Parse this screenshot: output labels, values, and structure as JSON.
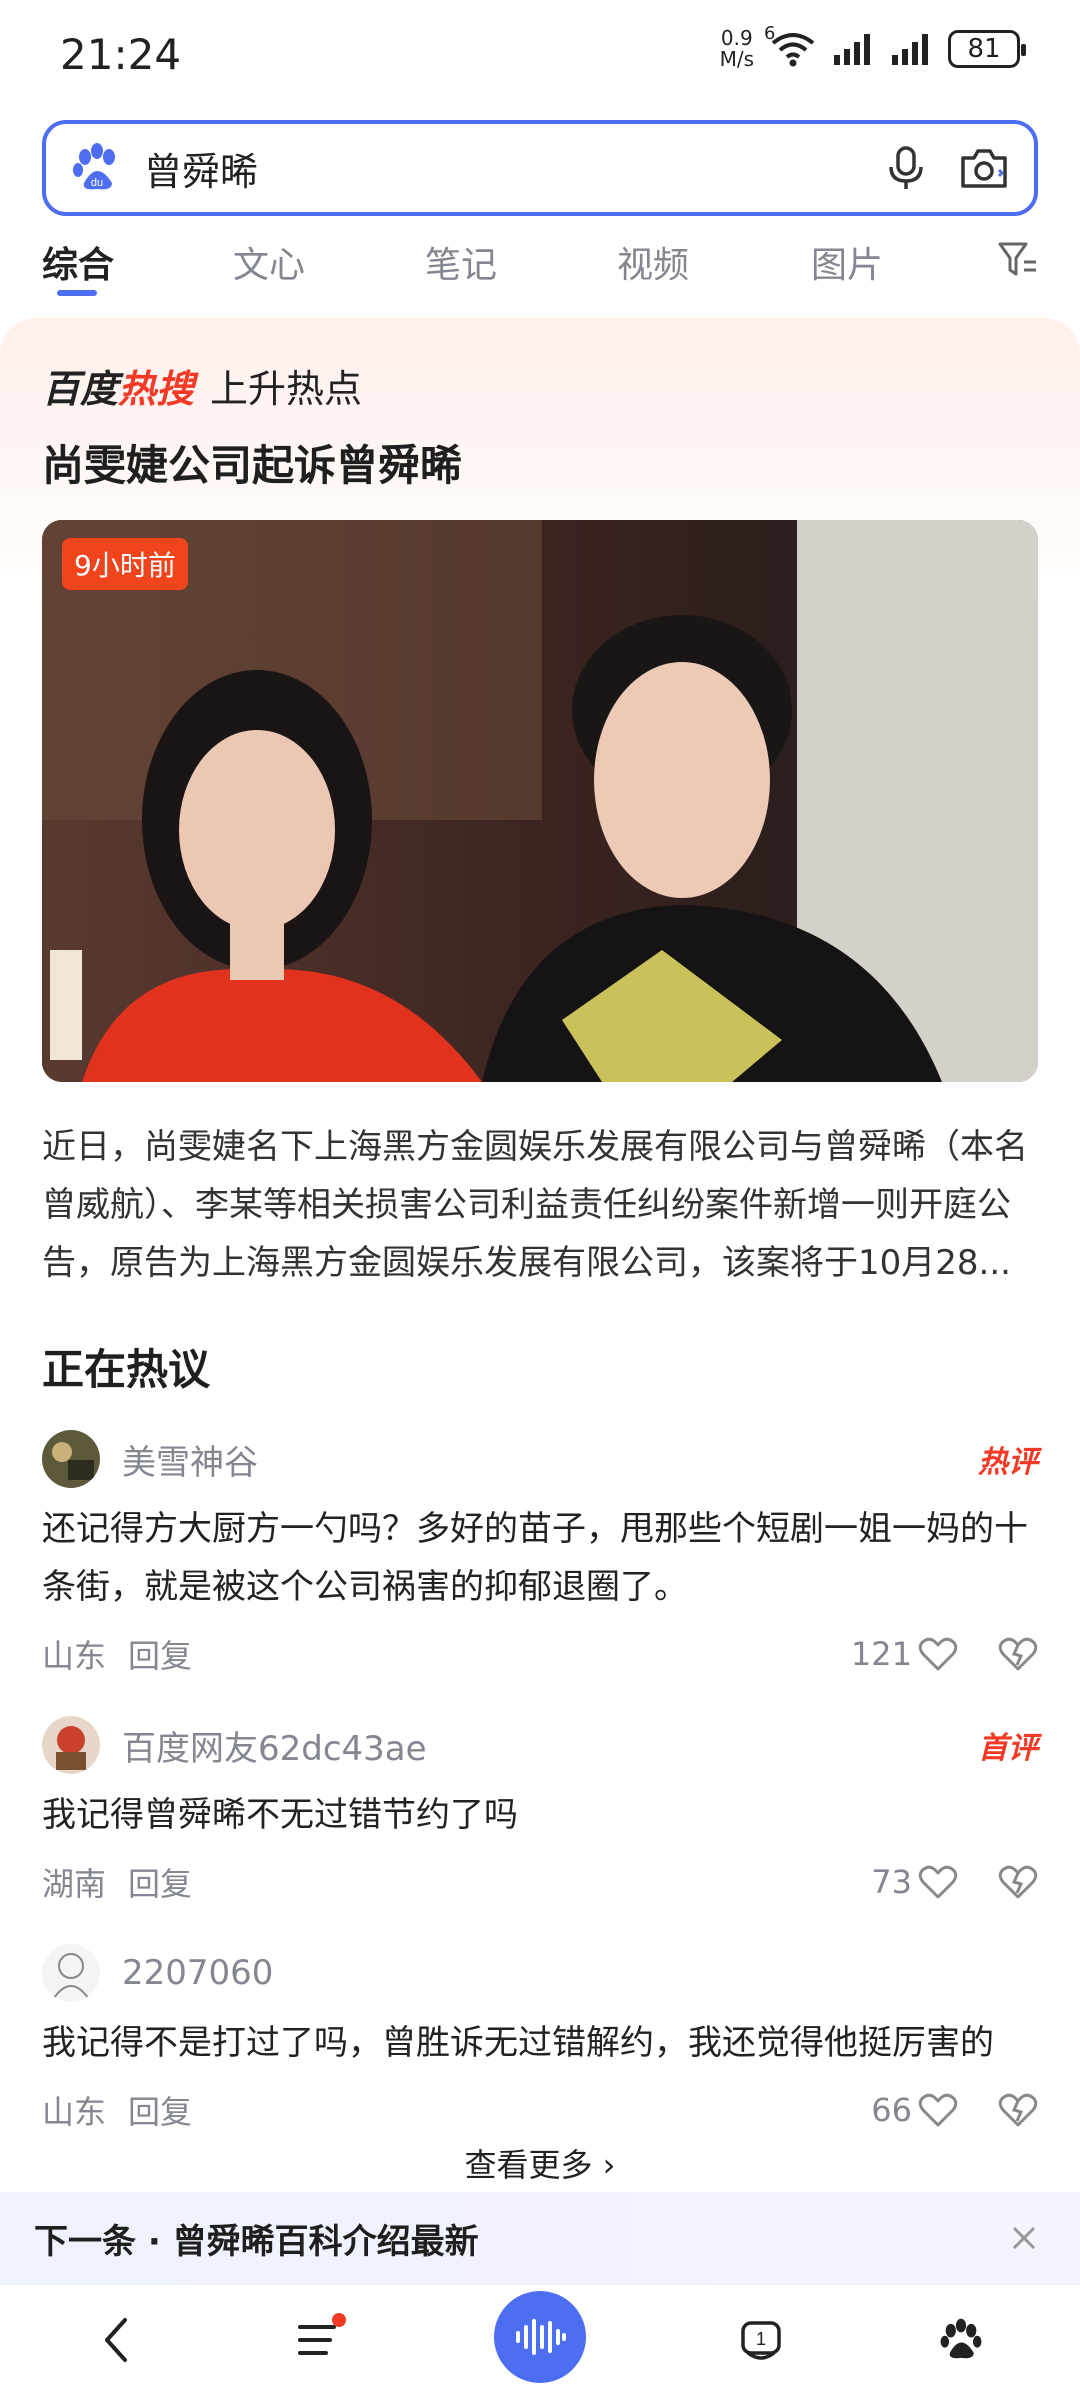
{
  "status_bar": {
    "time": "21:24",
    "net_speed_value": "0.9",
    "net_speed_unit": "M/s",
    "wifi_label": "6",
    "battery": "81"
  },
  "search": {
    "query": "曾舜晞"
  },
  "tabs": [
    {
      "label": "综合",
      "active": true
    },
    {
      "label": "文心",
      "active": false
    },
    {
      "label": "笔记",
      "active": false
    },
    {
      "label": "视频",
      "active": false
    },
    {
      "label": "图片",
      "active": false
    }
  ],
  "hot_card": {
    "logo_part1": "百度",
    "logo_part2": "热搜",
    "label": "上升热点",
    "headline": "尚雯婕公司起诉曾舜晞",
    "time_badge": "9小时前",
    "summary": "近日，尚雯婕名下上海黑方金圆娱乐发展有限公司与曾舜晞（本名曾威航）、李某等相关损害公司利益责任纠纷案件新增一则开庭公告，原告为上海黑方金圆娱乐发展有限公司，该案将于10月28..."
  },
  "discussion": {
    "title": "正在热议",
    "comments": [
      {
        "user": "美雪神谷",
        "badge": "热评",
        "text": "还记得方大厨方一勺吗？多好的苗子，甩那些个短剧一姐一妈的十条街，就是被这个公司祸害的抑郁退圈了。",
        "location": "山东",
        "reply": "回复",
        "likes": "121"
      },
      {
        "user": "百度网友62dc43ae",
        "badge": "首评",
        "text": "我记得曾舜晞不无过错节约了吗",
        "location": "湖南",
        "reply": "回复",
        "likes": "73"
      },
      {
        "user": "2207060",
        "badge": "",
        "text": "我记得不是打过了吗，曾胜诉无过错解约，我还觉得他挺厉害的",
        "location": "山东",
        "reply": "回复",
        "likes": "66"
      }
    ],
    "more": "查看更多 ›"
  },
  "next_bar": {
    "text": "下一条 · 曾舜晞百科介绍最新"
  },
  "colors": {
    "accent": "#4e6ef2",
    "hot_red": "#f23a26"
  }
}
